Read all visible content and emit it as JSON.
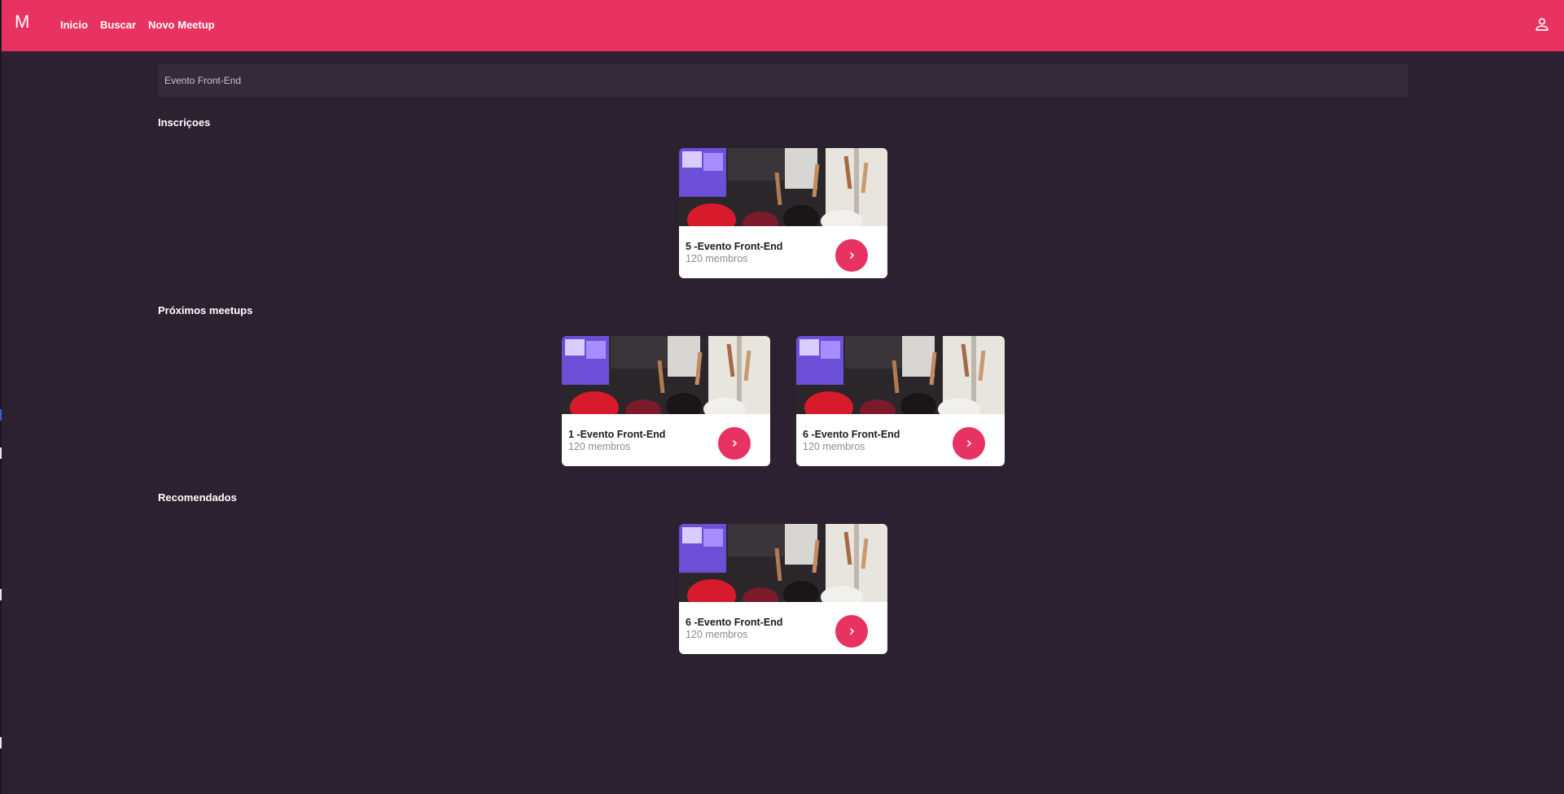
{
  "header": {
    "logo": "M",
    "nav": [
      "Inicio",
      "Buscar",
      "Novo Meetup"
    ]
  },
  "search": {
    "value": "Evento Front-End"
  },
  "sections": {
    "inscricoes": {
      "title": "Inscriçoes",
      "cards": [
        {
          "title": "5 -Evento Front-End",
          "members": "120 membros"
        }
      ]
    },
    "proximos": {
      "title": "Próximos meetups",
      "cards": [
        {
          "title": "1 -Evento Front-End",
          "members": "120 membros"
        },
        {
          "title": "6 -Evento Front-End",
          "members": "120 membros"
        }
      ]
    },
    "recomendados": {
      "title": "Recomendados",
      "cards": [
        {
          "title": "6 -Evento Front-End",
          "members": "120 membros"
        }
      ]
    }
  },
  "icons": {
    "profile": "person-outline-icon",
    "card_action": "chevron-right-icon"
  },
  "colors": {
    "brand": "#e83262",
    "background": "#2b2130",
    "search_bg": "#342b3a"
  }
}
